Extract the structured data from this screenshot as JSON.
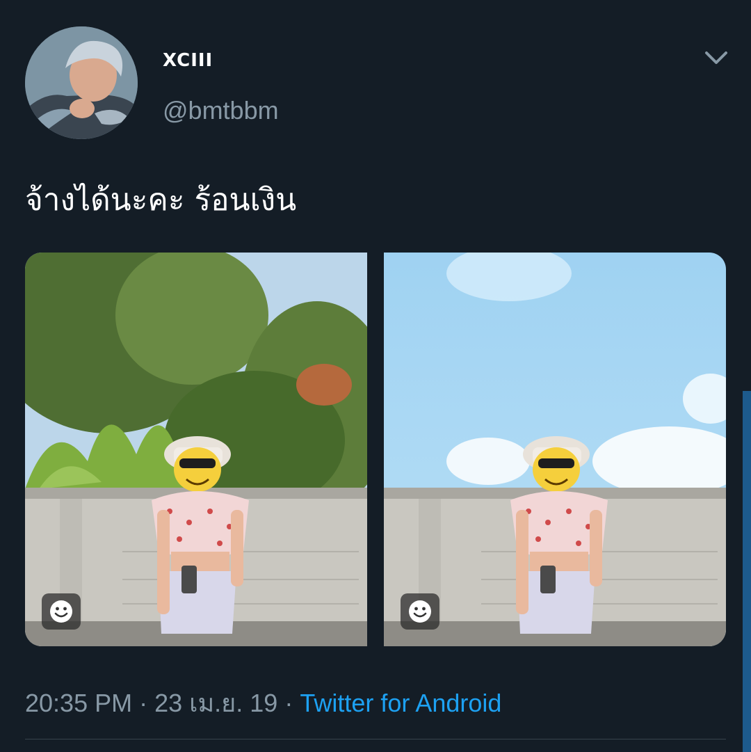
{
  "user": {
    "display_name": "XCIII",
    "handle": "@bmtbbm",
    "avatar_icon": "profile-avatar"
  },
  "tweet": {
    "text": "จ้างได้นะคะ ร้อนเงิน",
    "images": [
      {
        "icon": "photo-garden-original",
        "tag_icon": "face-tag-icon"
      },
      {
        "icon": "photo-sky-edited",
        "tag_icon": "face-tag-icon"
      }
    ]
  },
  "meta": {
    "time": "20:35 PM",
    "sep1": " · ",
    "date": "23 เม.ย. 19",
    "sep2": " · ",
    "source": "Twitter for Android"
  },
  "colors": {
    "background": "#141d26",
    "secondary_text": "#8899a6",
    "link": "#1da1f2"
  }
}
